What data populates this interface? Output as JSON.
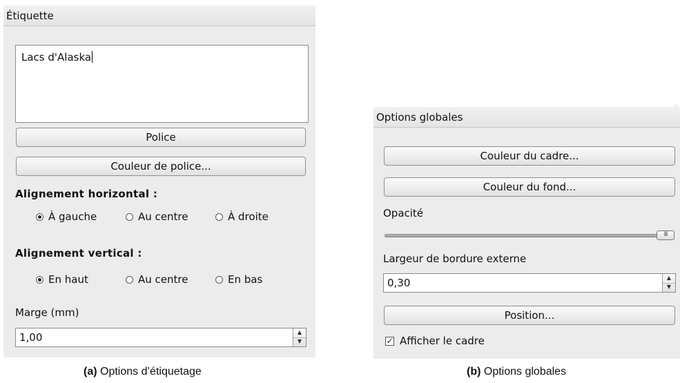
{
  "panel_a": {
    "title": "Étiquette",
    "label_text": "Lacs d'Alaska",
    "font_button": "Police",
    "font_color_button": "Couleur de police...",
    "h_align_title": "Alignement horizontal :",
    "h_align_options": [
      "À gauche",
      "Au centre",
      "À droite"
    ],
    "h_align_selected": "À gauche",
    "v_align_title": "Alignement vertical :",
    "v_align_options": [
      "En haut",
      "Au centre",
      "En bas"
    ],
    "v_align_selected": "En haut",
    "margin_label": "Marge (mm)",
    "margin_value": "1,00",
    "caption_prefix": "(a)",
    "caption_text": "Options d’étiquetage"
  },
  "panel_b": {
    "title": "Options globales",
    "frame_color_button": "Couleur du cadre...",
    "bg_color_button": "Couleur du fond...",
    "opacity_label": "Opacité",
    "opacity_fraction": 1.0,
    "border_width_label": "Largeur de bordure externe",
    "border_width_value": "0,30",
    "position_button": "Position...",
    "show_frame_label": "Afficher le cadre",
    "show_frame_checked": true,
    "caption_prefix": "(b)",
    "caption_text": "Options globales"
  },
  "icons": {
    "spin_up": "▲",
    "spin_down": "▼",
    "check": "✓",
    "slider_grip": "III"
  }
}
